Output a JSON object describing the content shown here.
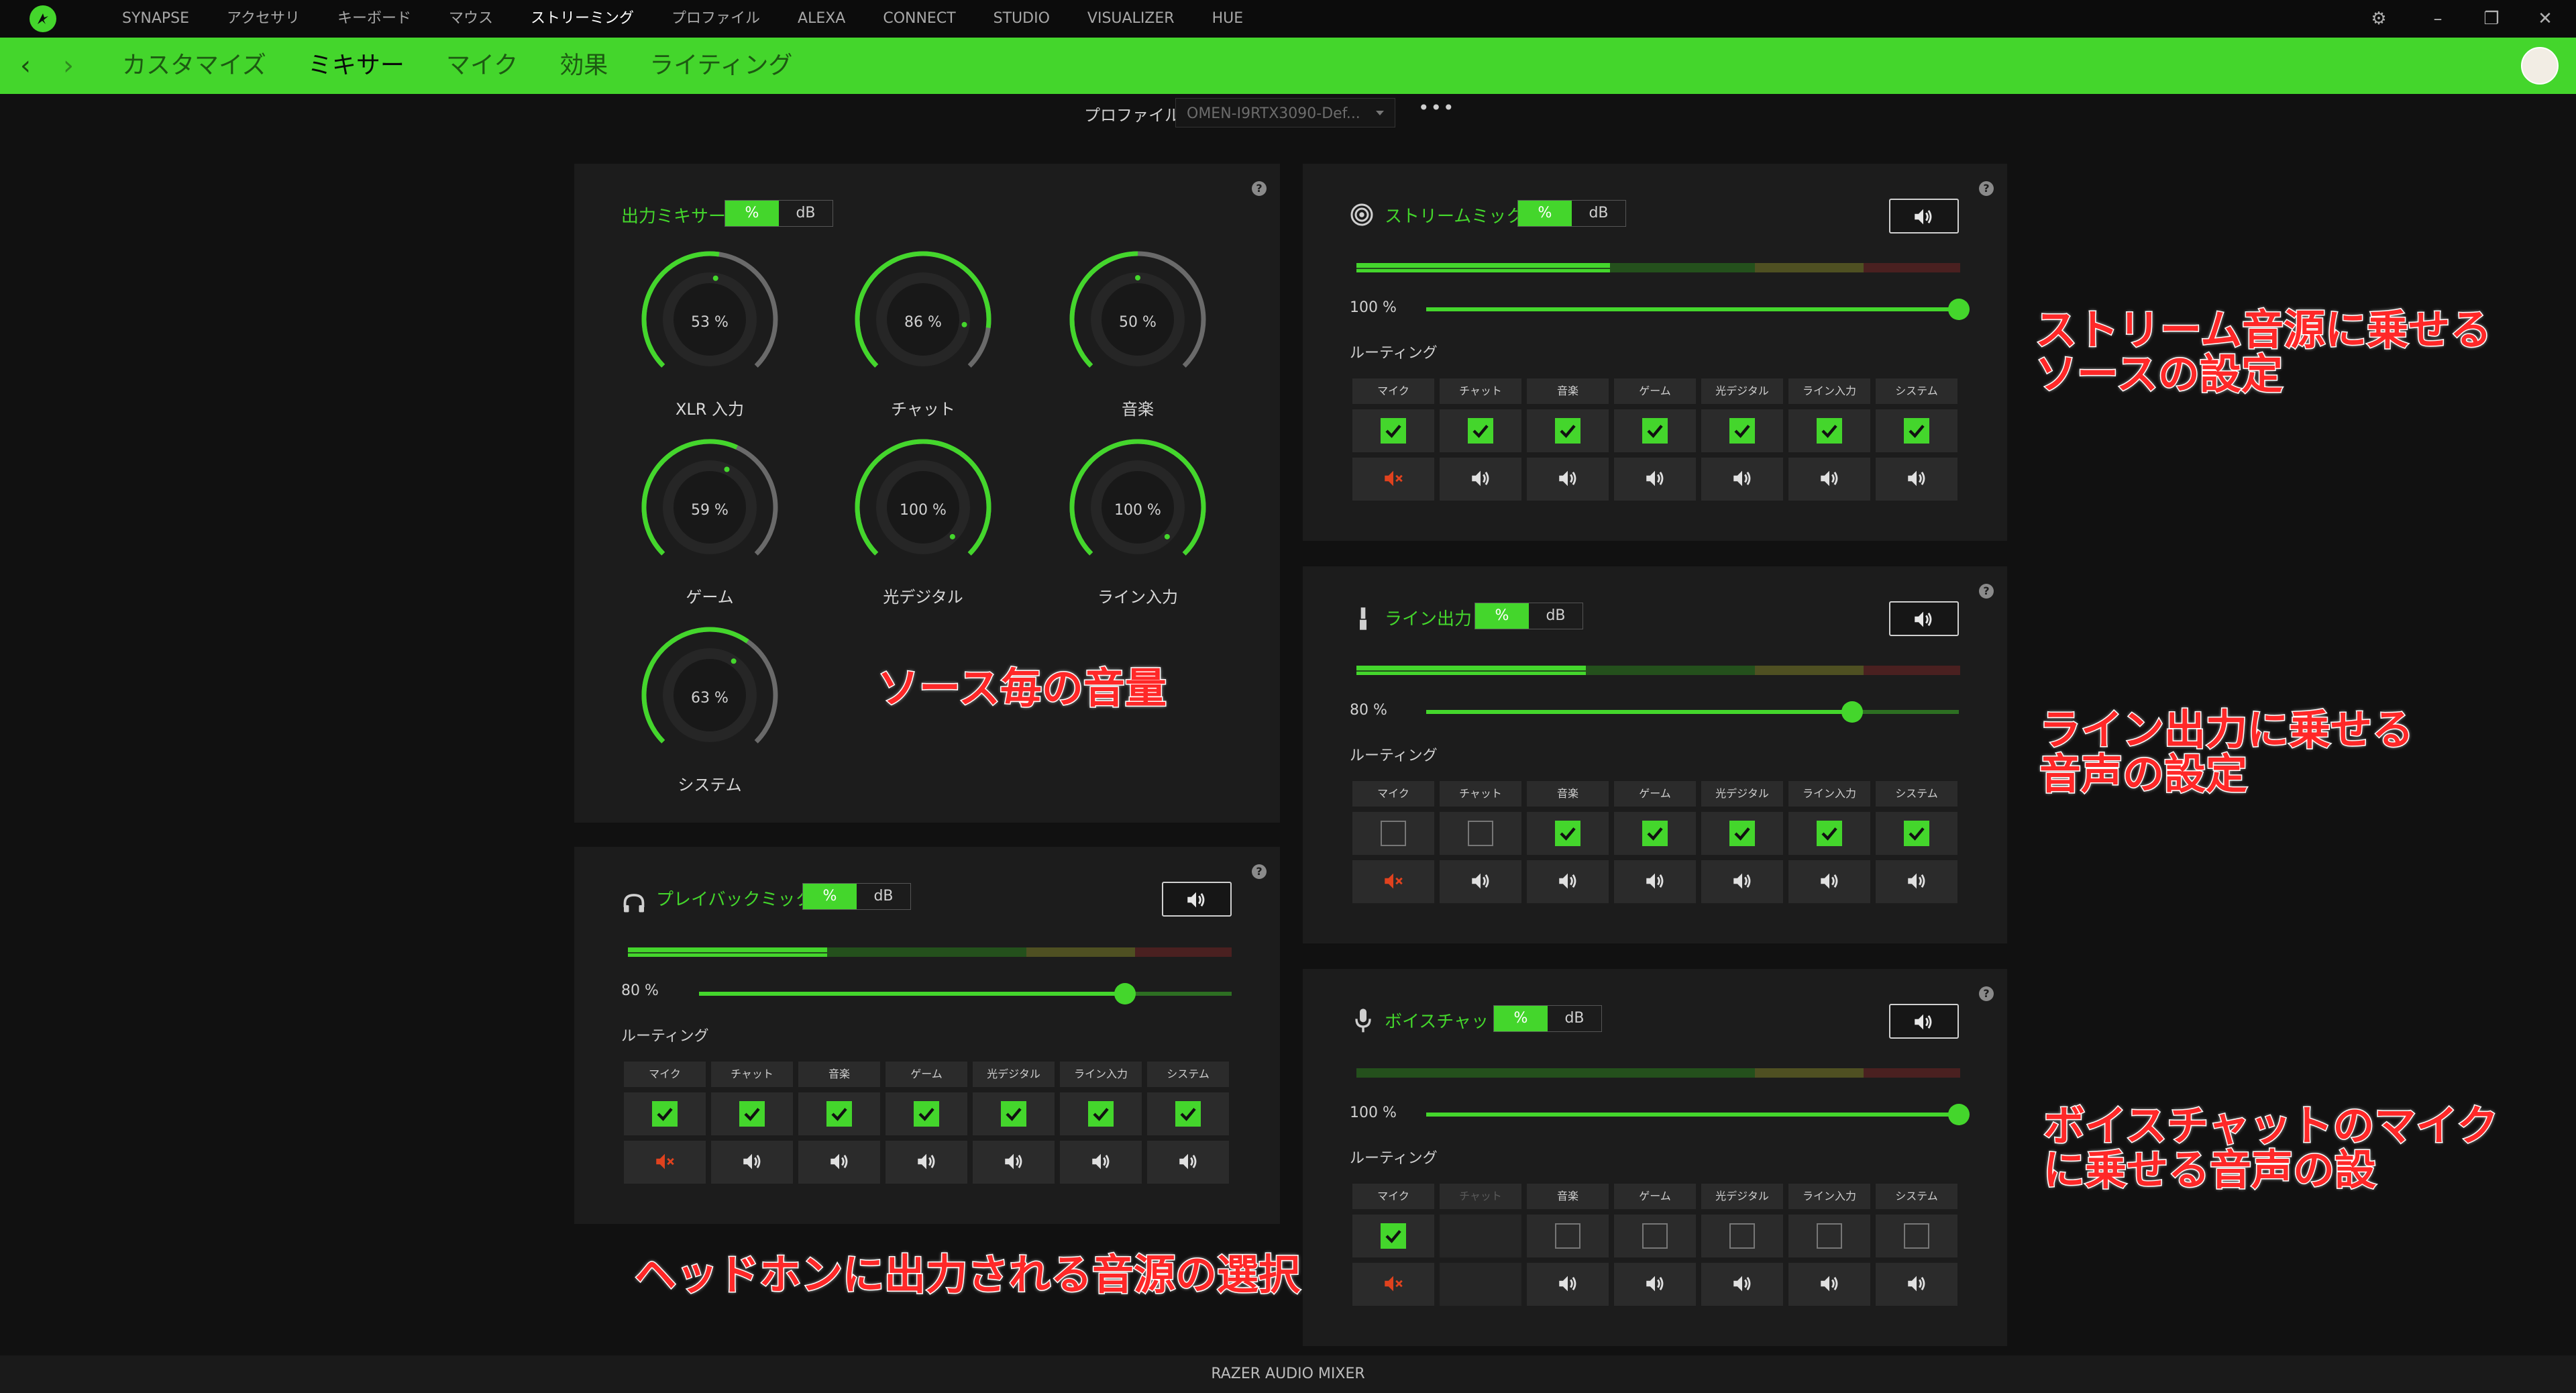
{
  "topnav": {
    "items": [
      {
        "label": "SYNAPSE",
        "active": false
      },
      {
        "label": "アクセサリ",
        "active": false
      },
      {
        "label": "キーボード",
        "active": false
      },
      {
        "label": "マウス",
        "active": false
      },
      {
        "label": "ストリーミング",
        "active": true
      },
      {
        "label": "プロファイル",
        "active": false
      },
      {
        "label": "ALEXA",
        "active": false
      },
      {
        "label": "CONNECT",
        "active": false
      },
      {
        "label": "STUDIO",
        "active": false
      },
      {
        "label": "VISUALIZER",
        "active": false
      },
      {
        "label": "HUE",
        "active": false
      }
    ]
  },
  "subnav": {
    "tabs": [
      {
        "label": "カスタマイズ",
        "active": false
      },
      {
        "label": "ミキサー",
        "active": true
      },
      {
        "label": "マイク",
        "active": false
      },
      {
        "label": "効果",
        "active": false
      },
      {
        "label": "ライティング",
        "active": false
      }
    ]
  },
  "profile": {
    "label": "プロファイル",
    "value": "OMEN-I9RTX3090-Def...",
    "more": "•••"
  },
  "toggle": {
    "percent": "%",
    "db": "dB"
  },
  "output_mixer": {
    "title": "出力ミキサー",
    "knobs": [
      {
        "label": "XLR 入力",
        "value": "53 %",
        "level": 53
      },
      {
        "label": "チャット",
        "value": "86 %",
        "level": 86
      },
      {
        "label": "音楽",
        "value": "50 %",
        "level": 50
      },
      {
        "label": "ゲーム",
        "value": "59 %",
        "level": 59
      },
      {
        "label": "光デジタル",
        "value": "100 %",
        "level": 100
      },
      {
        "label": "ライン入力",
        "value": "100 %",
        "level": 100
      },
      {
        "label": "システム",
        "value": "63 %",
        "level": 63
      }
    ]
  },
  "routing_label": "ルーティング",
  "mixes": [
    {
      "key": "stream",
      "title": "ストリームミックス",
      "icon": "broadcast-icon",
      "volume": "100 %",
      "level": 100,
      "meter": 0.42,
      "headers": [
        "マイク",
        "チャット",
        "音楽",
        "ゲーム",
        "光デジタル",
        "ライン入力",
        "システム"
      ],
      "header_dim": [
        false,
        false,
        false,
        false,
        false,
        false,
        false
      ],
      "checks": [
        "on",
        "on",
        "on",
        "on",
        "on",
        "on",
        "on"
      ],
      "muted": [
        true,
        false,
        false,
        false,
        false,
        false,
        false
      ]
    },
    {
      "key": "line",
      "title": "ライン出力",
      "icon": "line-out-icon",
      "volume": "80 %",
      "level": 80,
      "meter": 0.38,
      "headers": [
        "マイク",
        "チャット",
        "音楽",
        "ゲーム",
        "光デジタル",
        "ライン入力",
        "システム"
      ],
      "header_dim": [
        false,
        false,
        false,
        false,
        false,
        false,
        false
      ],
      "checks": [
        "off",
        "off",
        "on",
        "on",
        "on",
        "on",
        "on"
      ],
      "muted": [
        true,
        false,
        false,
        false,
        false,
        false,
        false
      ]
    },
    {
      "key": "voice",
      "title": "ボイスチャット",
      "icon": "microphone-icon",
      "volume": "100 %",
      "level": 100,
      "meter": 0,
      "headers": [
        "マイク",
        "チャット",
        "音楽",
        "ゲーム",
        "光デジタル",
        "ライン入力",
        "システム"
      ],
      "header_dim": [
        false,
        true,
        false,
        false,
        false,
        false,
        false
      ],
      "checks": [
        "on",
        "none",
        "off",
        "off",
        "off",
        "off",
        "off"
      ],
      "muted": [
        true,
        null,
        false,
        false,
        false,
        false,
        false
      ]
    },
    {
      "key": "playback",
      "title": "プレイバックミックス",
      "icon": "headphones-icon",
      "volume": "80 %",
      "level": 80,
      "meter": 0.33,
      "headers": [
        "マイク",
        "チャット",
        "音楽",
        "ゲーム",
        "光デジタル",
        "ライン入力",
        "システム"
      ],
      "header_dim": [
        false,
        false,
        false,
        false,
        false,
        false,
        false
      ],
      "checks": [
        "on",
        "on",
        "on",
        "on",
        "on",
        "on",
        "on"
      ],
      "muted": [
        true,
        false,
        false,
        false,
        false,
        false,
        false
      ]
    }
  ],
  "annotations": {
    "source_volume": "ソース毎の音量",
    "stream_line1": "ストリーム音源に乗せる",
    "stream_line2": "ソースの設定",
    "line_line1": "ライン出力に乗せる",
    "line_line2": "音声の設定",
    "voice_line1": "ボイスチャットのマイク",
    "voice_line2": "に乗せる音声の設",
    "headphone": "ヘッドホンに出力される音源の選択"
  },
  "footer": "RAZER AUDIO MIXER",
  "colors": {
    "accent": "#44d62c",
    "mute": "#e0421e",
    "annotation": "#ff2828"
  }
}
